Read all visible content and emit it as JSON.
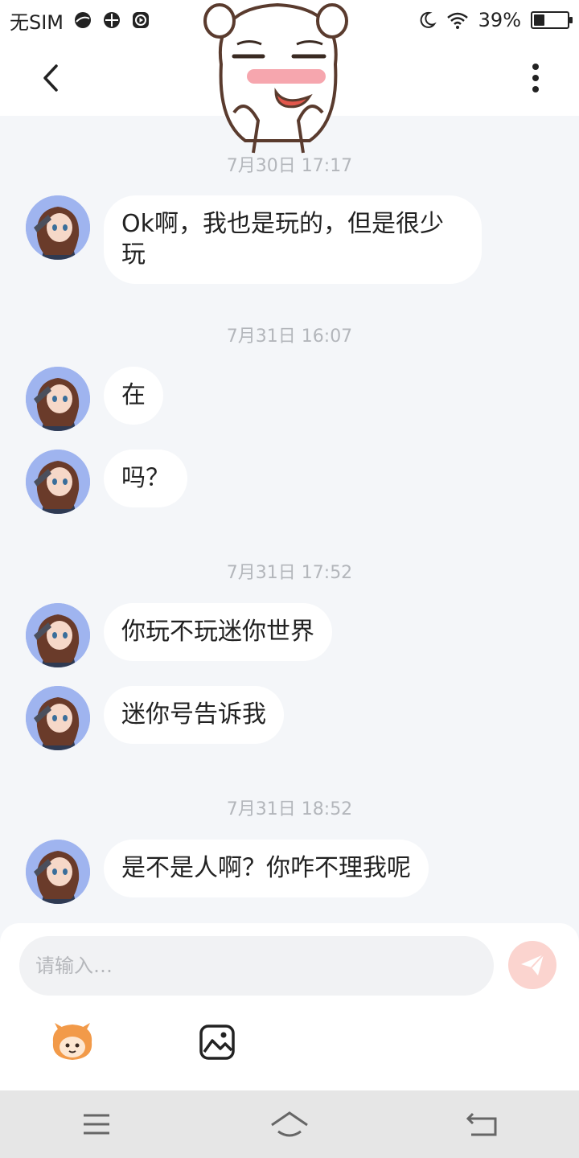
{
  "status_bar": {
    "carrier": "无SIM",
    "battery_percent": "39%",
    "battery_level": 0.39,
    "icons": [
      "browser-icon",
      "pinwheel-icon",
      "play-icon",
      "moon-icon",
      "wifi-icon",
      "battery-icon"
    ]
  },
  "header": {
    "back_icon": "chevron-left-icon",
    "more_icon": "more-vertical-icon"
  },
  "messages": [
    {
      "type": "timestamp",
      "text": "7月30日 17:17"
    },
    {
      "type": "message",
      "text": "Ok啊，我也是玩的，但是很少玩"
    },
    {
      "type": "timestamp",
      "text": "7月31日 16:07"
    },
    {
      "type": "message",
      "text": "在"
    },
    {
      "type": "message",
      "text": "吗？"
    },
    {
      "type": "timestamp",
      "text": "7月31日 17:52"
    },
    {
      "type": "message",
      "text": "你玩不玩迷你世界"
    },
    {
      "type": "message",
      "text": "迷你号告诉我"
    },
    {
      "type": "timestamp",
      "text": "7月31日 18:52"
    },
    {
      "type": "message",
      "text": "是不是人啊？你咋不理我呢"
    }
  ],
  "input": {
    "placeholder": "请输入…",
    "value": ""
  },
  "toolbar": {
    "emoji_icon": "mascot-emoji-icon",
    "image_icon": "image-icon",
    "send_icon": "paper-plane-icon"
  },
  "nav_bar": {
    "icons": [
      "menu-icon",
      "home-icon",
      "back-icon"
    ]
  },
  "colors": {
    "background": "#f4f6f9",
    "bubble": "#ffffff",
    "timestamp": "#b3b6bb",
    "send_button": "#fbd4cf",
    "nav_bar": "#e6e6e6"
  }
}
